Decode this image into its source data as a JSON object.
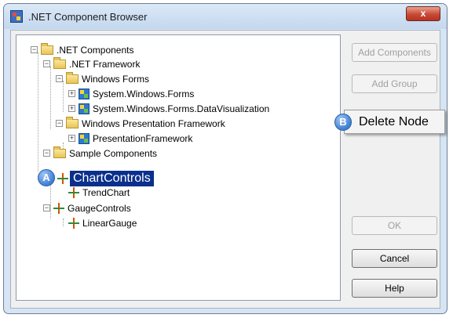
{
  "window": {
    "title": ".NET Component Browser",
    "close_label": "x"
  },
  "tree": {
    "nodes": [
      {
        "label": ".NET Components",
        "icon": "folder-icon",
        "expander": "−"
      },
      {
        "label": ".NET Framework",
        "icon": "folder-icon",
        "expander": "−"
      },
      {
        "label": "Windows Forms",
        "icon": "folder-icon",
        "expander": "−"
      },
      {
        "label": "System.Windows.Forms",
        "icon": "assembly-icon",
        "expander": "+"
      },
      {
        "label": "System.Windows.Forms.DataVisualization",
        "icon": "assembly-icon",
        "expander": "+"
      },
      {
        "label": "Windows Presentation Framework",
        "icon": "folder-icon",
        "expander": "−"
      },
      {
        "label": "PresentationFramework",
        "icon": "assembly-icon",
        "expander": "+"
      },
      {
        "label": "Sample Components",
        "icon": "folder-icon",
        "expander": "−"
      },
      {
        "label": "ChartControls",
        "icon": "control-icon",
        "selected": true
      },
      {
        "label": "TrendChart",
        "icon": "control-icon"
      },
      {
        "label": "GaugeControls",
        "icon": "control-icon",
        "expander": "−"
      },
      {
        "label": "LinearGauge",
        "icon": "control-icon"
      }
    ]
  },
  "buttons": {
    "add_components": "Add Components",
    "add_group": "Add Group",
    "ok": "OK",
    "cancel": "Cancel",
    "help": "Help"
  },
  "context_menu": {
    "delete_node": "Delete Node"
  },
  "callouts": {
    "a": "A",
    "b": "B"
  },
  "colors": {
    "selection": "#0a2f8c",
    "callout": "#3f7fd2",
    "close_button": "#c84a35"
  }
}
